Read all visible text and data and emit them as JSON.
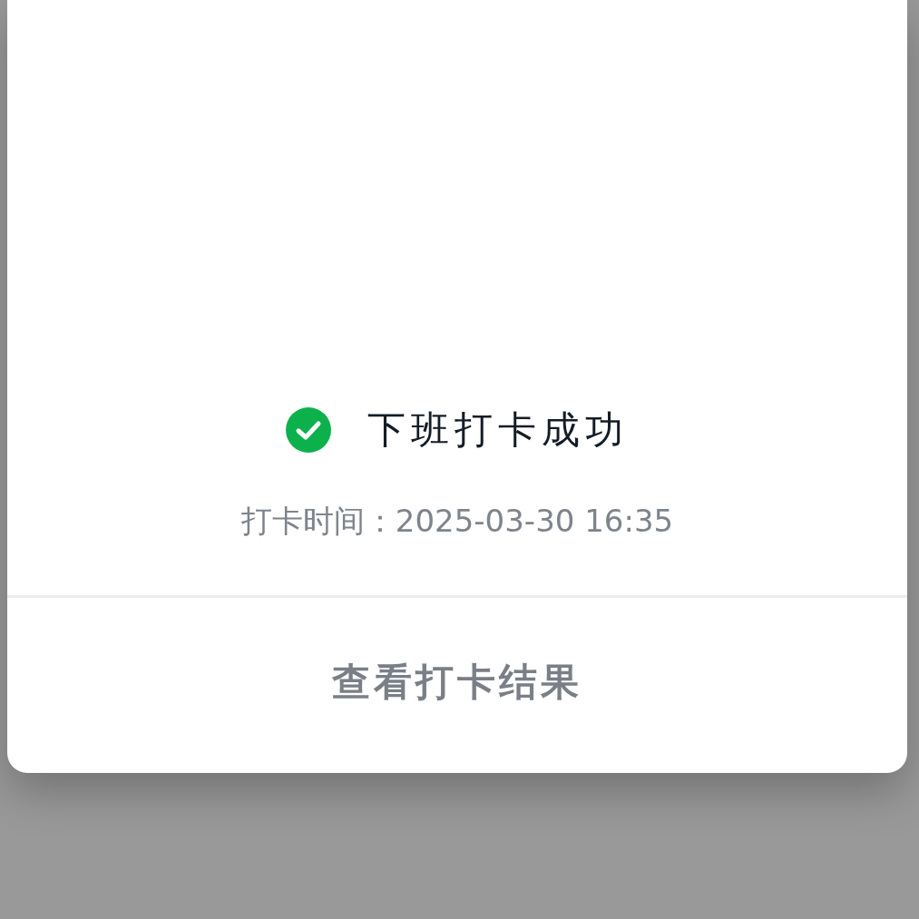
{
  "result": {
    "succeeded": true,
    "title": "下班打卡成功",
    "time": "打卡时间：2025-03-30 16:35"
  },
  "buttons": [
    "查看打卡结果"
  ]
}
